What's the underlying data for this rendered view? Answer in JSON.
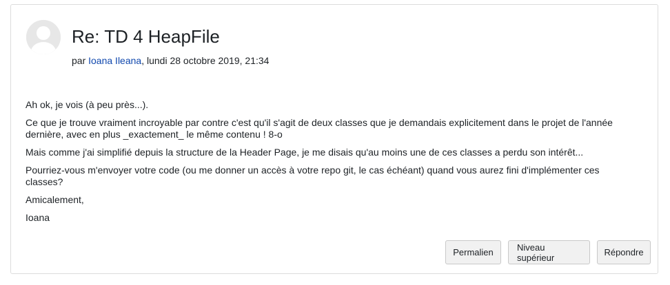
{
  "post": {
    "subject": "Re: TD 4 HeapFile",
    "byline_prefix": "par ",
    "author": "Ioana Ileana",
    "date": ", lundi 28 octobre 2019, 21:34",
    "avatar_icon": "user-avatar-icon",
    "paragraphs": [
      "Ah ok, je vois (à peu près...).",
      "Ce que je trouve vraiment incroyable par contre c'est qu'il s'agit de deux classes que je demandais explicitement dans le projet de l'année dernière, avec en plus _exactement_ le même contenu ! 8-o",
      "Mais comme j'ai simplifié depuis la structure de la Header Page, je me disais qu'au moins une de ces classes a perdu son intérêt...",
      "Pourriez-vous m'envoyer votre code (ou me donner un accès à votre repo git, le cas échéant) quand vous aurez fini d'implémenter ces classes?",
      "Amicalement,",
      "Ioana"
    ]
  },
  "actions": {
    "permalink": "Permalien",
    "parent": "Niveau supérieur",
    "reply": "Répondre"
  },
  "colors": {
    "link": "#0f47ad",
    "border": "#dcdcdc",
    "button_bg": "#f1f1f1"
  }
}
